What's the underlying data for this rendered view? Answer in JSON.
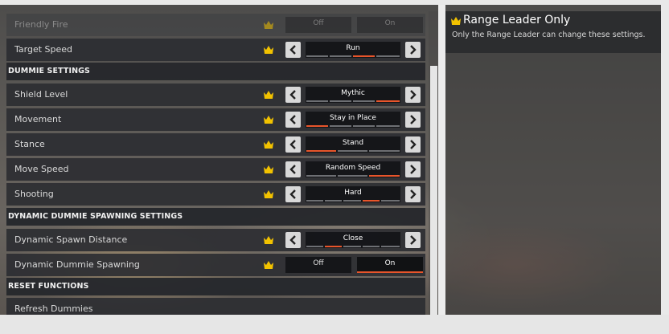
{
  "colors": {
    "accent": "#e8552b",
    "crown": "#f2c200",
    "row_bg": "#2c2e32",
    "text": "#d9d9d9"
  },
  "rows": {
    "friendly_fire": {
      "label": "Friendly Fire",
      "off": "Off",
      "on": "On"
    },
    "target_speed": {
      "label": "Target Speed",
      "value": "Run"
    },
    "shield_level": {
      "label": "Shield Level",
      "value": "Mythic"
    },
    "movement": {
      "label": "Movement",
      "value": "Stay in Place"
    },
    "stance": {
      "label": "Stance",
      "value": "Stand"
    },
    "move_speed": {
      "label": "Move Speed",
      "value": "Random Speed"
    },
    "shooting": {
      "label": "Shooting",
      "value": "Hard"
    },
    "dynamic_spawn_distance": {
      "label": "Dynamic Spawn Distance",
      "value": "Close"
    },
    "dynamic_dummie_spawning": {
      "label": "Dynamic Dummie Spawning",
      "off": "Off",
      "on": "On"
    },
    "refresh_dummies": {
      "label": "Refresh Dummies"
    }
  },
  "sections": {
    "dummie_settings": "DUMMIE SETTINGS",
    "dynamic_spawning": "DYNAMIC DUMMIE SPAWNING SETTINGS",
    "reset_functions": "RESET FUNCTIONS"
  },
  "right_panel": {
    "title": "Range Leader Only",
    "description": "Only the Range Leader can change these settings."
  },
  "icons": [
    "crown-icon",
    "chevron-left-icon",
    "chevron-right-icon"
  ]
}
